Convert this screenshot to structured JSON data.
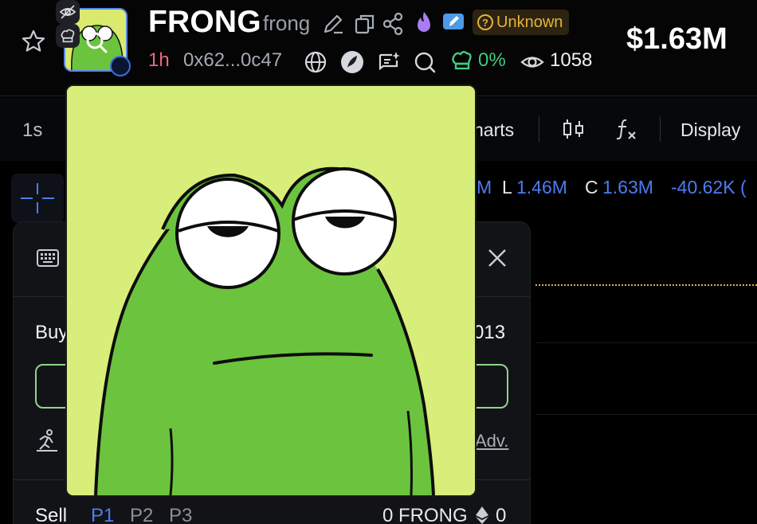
{
  "header": {
    "title": "FRONG",
    "ticker": "frong",
    "status": "Unknown",
    "market_cap": "$1.63M",
    "age": "1h",
    "address": "0x62...0c47",
    "holders_pct": "0%",
    "views": "1058"
  },
  "chart_toolbar": {
    "timeframe": "1s",
    "charts_label": "harts",
    "display_label": "Display"
  },
  "ohlc": {
    "h_fragment": "M",
    "l_label": "L",
    "l_value": "1.46M",
    "c_label": "C",
    "c_value": "1.63M",
    "change": "-40.62K ("
  },
  "trade_panel": {
    "buy_label": "Buy",
    "buy_right_fragment": "013",
    "adv_label": "Adv.",
    "sell_label": "Sell",
    "presets": [
      "P1",
      "P2",
      "P3"
    ],
    "sell_balance": "0 FRONG",
    "eth_balance": "0"
  },
  "colors": {
    "accent_blue": "#4a7df0",
    "age_red": "#e8697c",
    "positive_green": "#3fcc7c",
    "status_amber": "#e8b23a",
    "frog_green": "#6cc43e",
    "frog_bg": "#d8ee7a"
  },
  "icons": [
    "star-icon",
    "hidden-eye-icon",
    "chef-hat-icon",
    "search-icon",
    "edit-icon",
    "copy-icon",
    "share-icon",
    "flame-icon",
    "pencil-badge-icon",
    "question-icon",
    "globe-icon",
    "feather-icon",
    "sparkle-chat-icon",
    "search-circle-icon",
    "chef-hat-icon",
    "eye-icon",
    "candlestick-icon",
    "function-icon",
    "keyboard-icon",
    "close-icon",
    "runner-icon",
    "ethereum-icon"
  ]
}
